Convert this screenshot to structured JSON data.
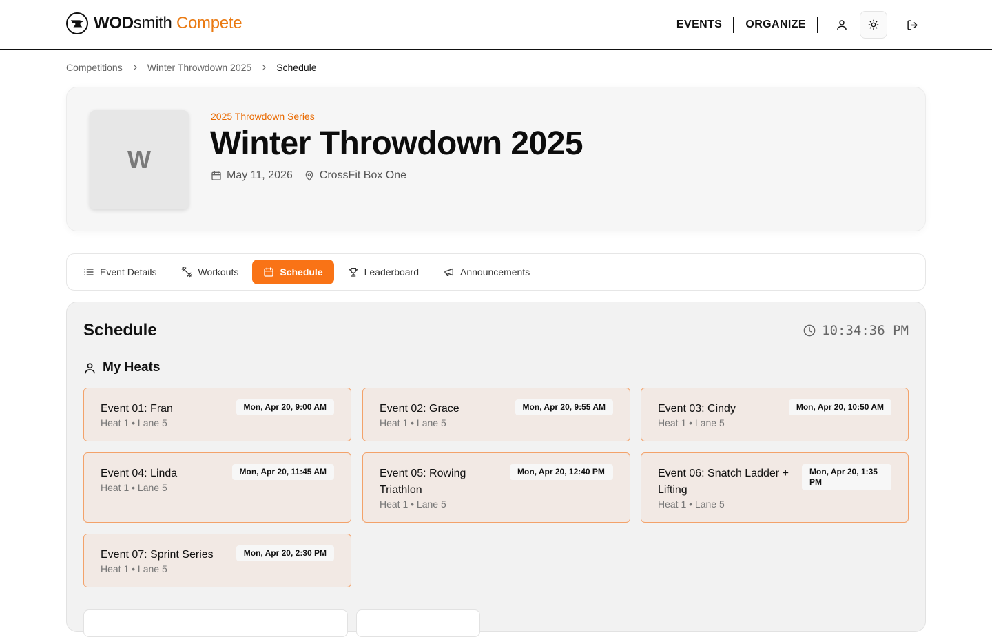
{
  "brand": {
    "part1": "WOD",
    "part2": "smith",
    "part3": " Compete"
  },
  "nav": {
    "events": "EVENTS",
    "organize": "ORGANIZE"
  },
  "breadcrumb": {
    "items": [
      "Competitions",
      "Winter Throwdown 2025",
      "Schedule"
    ]
  },
  "hero": {
    "thumb_letter": "W",
    "series": "2025 Throwdown Series",
    "title": "Winter Throwdown 2025",
    "date": "May 11, 2026",
    "location": "CrossFit Box One"
  },
  "tabs": [
    {
      "label": "Event Details",
      "icon": "list-icon"
    },
    {
      "label": "Workouts",
      "icon": "dumbbell-icon"
    },
    {
      "label": "Schedule",
      "icon": "calendar-icon",
      "active": true
    },
    {
      "label": "Leaderboard",
      "icon": "trophy-icon"
    },
    {
      "label": "Announcements",
      "icon": "megaphone-icon"
    }
  ],
  "schedule": {
    "title": "Schedule",
    "clock": "10:34:36 PM",
    "my_heats_label": "My Heats",
    "heats": [
      {
        "name": "Event 01: Fran",
        "sub": "Heat 1 • Lane 5",
        "time": "Mon, Apr 20, 9:00 AM"
      },
      {
        "name": "Event 02: Grace",
        "sub": "Heat 1 • Lane 5",
        "time": "Mon, Apr 20, 9:55 AM"
      },
      {
        "name": "Event 03: Cindy",
        "sub": "Heat 1 • Lane 5",
        "time": "Mon, Apr 20, 10:50 AM"
      },
      {
        "name": "Event 04: Linda",
        "sub": "Heat 1 • Lane 5",
        "time": "Mon, Apr 20, 11:45 AM"
      },
      {
        "name": "Event 05: Rowing Triathlon",
        "sub": "Heat 1 • Lane 5",
        "time": "Mon, Apr 20, 12:40 PM"
      },
      {
        "name": "Event 06: Snatch Ladder + Lifting",
        "sub": "Heat 1 • Lane 5",
        "time": "Mon, Apr 20, 1:35 PM"
      },
      {
        "name": "Event 07: Sprint Series",
        "sub": "Heat 1 • Lane 5",
        "time": "Mon, Apr 20, 2:30 PM"
      }
    ]
  },
  "colors": {
    "accent": "#f97316",
    "accent_text": "#ea6a00",
    "card_bg": "#f2e9e4",
    "card_border": "#f3a26a"
  }
}
